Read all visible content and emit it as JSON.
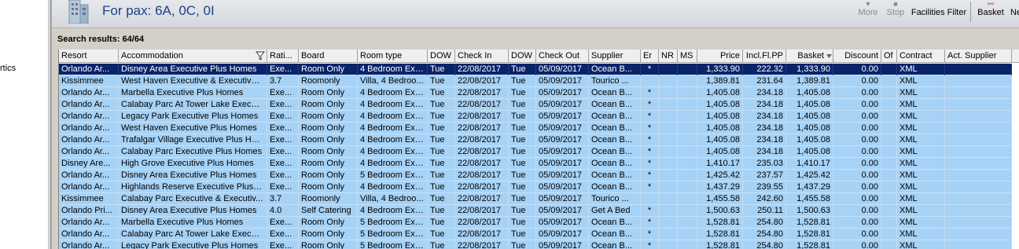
{
  "left_panel": {
    "partial_text": "rtics"
  },
  "header": {
    "title": "For pax: 6A, 0C, 0I"
  },
  "toolbar": {
    "more_label": "More",
    "stop_label": "Stop",
    "facilities_filter_label": "Facilities Filter",
    "basket_label": "Basket",
    "next_label": "Ne"
  },
  "results": {
    "label": "Search results: 64/64"
  },
  "colors": {
    "row_bg": "#a6d2f6",
    "selected_bg": "#0a246a",
    "title_color": "#1d3f8a"
  },
  "columns": [
    "Resort",
    "Accommodation",
    "Rati...",
    "Board",
    "Room type",
    "DOW",
    "Check In",
    "DOW",
    "Check Out",
    "Supplier",
    "Er",
    "NR",
    "MS",
    "Price",
    "Incl.Fl.PP",
    "Basket",
    "Discount",
    "Of",
    "Contract",
    "Act. Supplier"
  ],
  "rows": [
    [
      "Orlando Ar...",
      "Disney Area Executive Plus Homes",
      "Exe...",
      "Room Only",
      "4 Bedroom Exe...",
      "Tue",
      "22/08/2017",
      "Tue",
      "05/09/2017",
      "Ocean B...",
      "*",
      "",
      "",
      "1,333.90",
      "222.32",
      "1,333.90",
      "0.00",
      "",
      "XML",
      ""
    ],
    [
      "Kissimmee",
      "West Haven Executive & Executive ...",
      "3.7",
      "Roomonly",
      "Villa, 4 Bedroo...",
      "Tue",
      "22/08/2017",
      "Tue",
      "05/09/2017",
      "Tourico ...",
      "",
      "",
      "",
      "1,389.81",
      "231.64",
      "1,389.81",
      "0.00",
      "",
      "XML",
      ""
    ],
    [
      "Orlando Ar...",
      "Marbella Executive Plus Homes",
      "Exe...",
      "Room Only",
      "4 Bedroom Exe...",
      "Tue",
      "22/08/2017",
      "Tue",
      "05/09/2017",
      "Ocean B...",
      "*",
      "",
      "",
      "1,405.08",
      "234.18",
      "1,405.08",
      "0.00",
      "",
      "XML",
      ""
    ],
    [
      "Orlando Ar...",
      "Calabay Parc At Tower Lake Execut...",
      "Exe...",
      "Room Only",
      "4 Bedroom Exe...",
      "Tue",
      "22/08/2017",
      "Tue",
      "05/09/2017",
      "Ocean B...",
      "*",
      "",
      "",
      "1,405.08",
      "234.18",
      "1,405.08",
      "0.00",
      "",
      "XML",
      ""
    ],
    [
      "Orlando Ar...",
      "Legacy Park Executive Plus Homes",
      "Exe...",
      "Room Only",
      "4 Bedroom Exe...",
      "Tue",
      "22/08/2017",
      "Tue",
      "05/09/2017",
      "Ocean B...",
      "*",
      "",
      "",
      "1,405.08",
      "234.18",
      "1,405.08",
      "0.00",
      "",
      "XML",
      ""
    ],
    [
      "Orlando Ar...",
      "West Haven Executive Plus Homes",
      "Exe...",
      "Room Only",
      "4 Bedroom Exe...",
      "Tue",
      "22/08/2017",
      "Tue",
      "05/09/2017",
      "Ocean B...",
      "*",
      "",
      "",
      "1,405.08",
      "234.18",
      "1,405.08",
      "0.00",
      "",
      "XML",
      ""
    ],
    [
      "Orlando Ar...",
      "Trafalgar Village Executive Plus Homes",
      "Exe...",
      "Room Only",
      "4 Bedroom Exe...",
      "Tue",
      "22/08/2017",
      "Tue",
      "05/09/2017",
      "Ocean B...",
      "*",
      "",
      "",
      "1,405.08",
      "234.18",
      "1,405.08",
      "0.00",
      "",
      "XML",
      ""
    ],
    [
      "Orlando Ar...",
      "Calabay Parc Executive Plus Homes",
      "Exe...",
      "Room Only",
      "4 Bedroom Exe...",
      "Tue",
      "22/08/2017",
      "Tue",
      "05/09/2017",
      "Ocean B...",
      "*",
      "",
      "",
      "1,405.08",
      "234.18",
      "1,405.08",
      "0.00",
      "",
      "XML",
      ""
    ],
    [
      "Disney Are...",
      "High Grove Executive Plus Homes",
      "Exe...",
      "Room Only",
      "4 Bedroom Exe...",
      "Tue",
      "22/08/2017",
      "Tue",
      "05/09/2017",
      "Ocean B...",
      "*",
      "",
      "",
      "1,410.17",
      "235.03",
      "1,410.17",
      "0.00",
      "",
      "XML",
      ""
    ],
    [
      "Orlando Ar...",
      "Disney Area Executive Plus Homes",
      "Exe...",
      "Room Only",
      "5 Bedroom Exe...",
      "Tue",
      "22/08/2017",
      "Tue",
      "05/09/2017",
      "Ocean B...",
      "*",
      "",
      "",
      "1,425.42",
      "237.57",
      "1,425.42",
      "0.00",
      "",
      "XML",
      ""
    ],
    [
      "Orlando Ar...",
      "Highlands Reserve Executive Plus H...",
      "Exe...",
      "Room Only",
      "4 Bedroom Exe...",
      "Tue",
      "22/08/2017",
      "Tue",
      "05/09/2017",
      "Ocean B...",
      "*",
      "",
      "",
      "1,437.29",
      "239.55",
      "1,437.29",
      "0.00",
      "",
      "XML",
      ""
    ],
    [
      "Kissimmee",
      "Calabay Parc Executive & Executiv...",
      "3.7",
      "Roomonly",
      "Villa, 4 Bedroo...",
      "Tue",
      "22/08/2017",
      "Tue",
      "05/09/2017",
      "Tourico ...",
      "",
      "",
      "",
      "1,455.58",
      "242.60",
      "1,455.58",
      "0.00",
      "",
      "XML",
      ""
    ],
    [
      "Orlando Pri...",
      "Disney Area Executive Plus Homes",
      "4.0",
      "Self Catering",
      "4 Bedroom Exe...",
      "Tue",
      "22/08/2017",
      "Tue",
      "05/09/2017",
      "Get A Bed",
      "*",
      "",
      "",
      "1,500.63",
      "250.11",
      "1,500.63",
      "0.00",
      "",
      "XML",
      ""
    ],
    [
      "Orlando Ar...",
      "Marbella Executive Plus Homes",
      "Exe...",
      "Room Only",
      "5 Bedroom Exe...",
      "Tue",
      "22/08/2017",
      "Tue",
      "05/09/2017",
      "Ocean B...",
      "*",
      "",
      "",
      "1,528.81",
      "254.80",
      "1,528.81",
      "0.00",
      "",
      "XML",
      ""
    ],
    [
      "Orlando Ar...",
      "Calabay Parc At Tower Lake Execut...",
      "Exe...",
      "Room Only",
      "5 Bedroom Exe...",
      "Tue",
      "22/08/2017",
      "Tue",
      "05/09/2017",
      "Ocean B...",
      "*",
      "",
      "",
      "1,528.81",
      "254.80",
      "1,528.81",
      "0.00",
      "",
      "XML",
      ""
    ],
    [
      "Orlando Ar...",
      "Legacy Park Executive Plus Homes",
      "Exe...",
      "Room Only",
      "5 Bedroom Exe...",
      "Tue",
      "22/08/2017",
      "Tue",
      "05/09/2017",
      "Ocean B...",
      "*",
      "",
      "",
      "1,528.81",
      "254.80",
      "1,528.81",
      "0.00",
      "",
      "XML",
      ""
    ]
  ]
}
